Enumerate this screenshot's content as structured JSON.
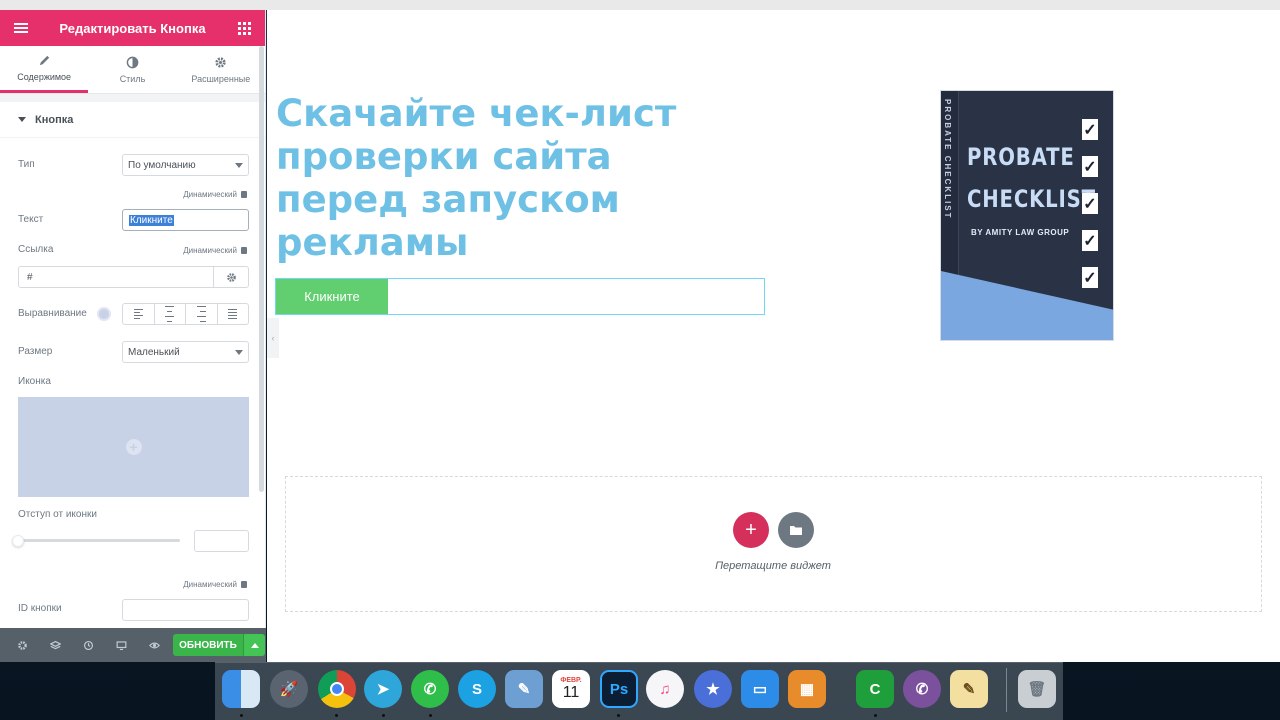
{
  "panel": {
    "title": "Редактировать Кнопка",
    "tabs": [
      {
        "label": "Содержимое",
        "icon": "pencil-icon"
      },
      {
        "label": "Стиль",
        "icon": "contrast-icon"
      },
      {
        "label": "Расширенные",
        "icon": "gear-icon"
      }
    ],
    "section_title": "Кнопка",
    "type": {
      "label": "Тип",
      "value": "По умолчанию"
    },
    "dynamic_label": "Динамический",
    "text": {
      "label": "Текст",
      "value": "Кликните"
    },
    "link": {
      "label": "Ссылка",
      "value": "#"
    },
    "alignment": {
      "label": "Выравнивание"
    },
    "size": {
      "label": "Размер",
      "value": "Маленький"
    },
    "icon": {
      "label": "Иконка"
    },
    "icon_spacing": {
      "label": "Отступ от иконки"
    },
    "button_id": {
      "label": "ID кнопки"
    },
    "footer": {
      "update_label": "ОБНОВИТЬ"
    }
  },
  "canvas": {
    "headline": "Скачайте чек-лист проверки сайта перед запуском рекламы",
    "button_text": "Кликните",
    "book": {
      "spine": "PROBATE CHECKLIST",
      "title_line1": "PROBATE",
      "title_line2": "CHECKLIST",
      "byline": "BY AMITY LAW GROUP"
    },
    "drop_text": "Перетащите виджет"
  },
  "dock": {
    "calendar_month": "ФЕВР.",
    "calendar_day": "11",
    "apps": [
      "finder-icon",
      "launchpad-icon",
      "chrome-icon",
      "telegram-icon",
      "whatsapp-icon",
      "skype-icon",
      "preview-icon",
      "calendar-icon",
      "photoshop-icon",
      "itunes-icon",
      "imovie-icon",
      "keynote-icon",
      "calculator-icon",
      "camtasia-icon",
      "viber-icon",
      "notes-icon",
      "trash-icon"
    ]
  },
  "colors": {
    "accent": "#e6306b",
    "headline": "#6ec1e4",
    "button": "#61ce70",
    "update": "#39b54a"
  }
}
